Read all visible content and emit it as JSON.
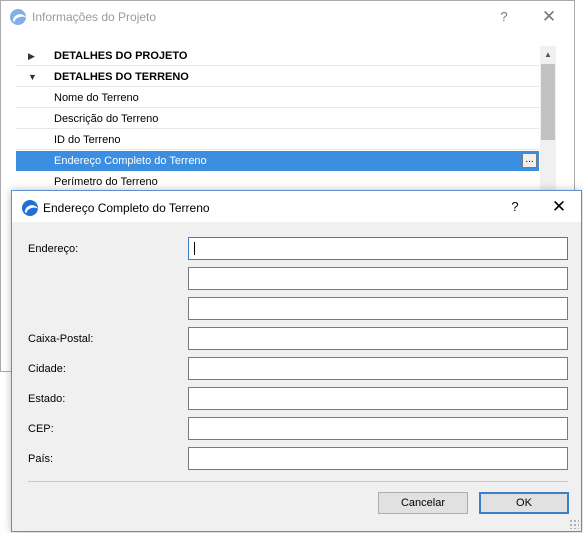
{
  "background_window": {
    "title": "Informações do Projeto",
    "help_glyph": "?",
    "close_glyph": "✕",
    "tree": [
      {
        "label": "DETALHES DO PROJETO",
        "kind": "header",
        "expanded": false
      },
      {
        "label": "DETALHES DO TERRENO",
        "kind": "header",
        "expanded": true
      },
      {
        "label": "Nome do Terreno",
        "kind": "item"
      },
      {
        "label": "Descrição do Terreno",
        "kind": "item"
      },
      {
        "label": "ID do Terreno",
        "kind": "item"
      },
      {
        "label": "Endereço Completo do Terreno",
        "kind": "item",
        "selected": true,
        "browse_glyph": "..."
      },
      {
        "label": "Perímetro do Terreno",
        "kind": "item"
      }
    ]
  },
  "dialog": {
    "title": "Endereço Completo do Terreno",
    "help_glyph": "?",
    "close_glyph": "✕",
    "fields": {
      "address_label": "Endereço:",
      "address_line1": "",
      "address_line2": "",
      "address_line3": "",
      "postal_box_label": "Caixa-Postal:",
      "postal_box": "",
      "city_label": "Cidade:",
      "city": "",
      "state_label": "Estado:",
      "state": "",
      "zip_label": "CEP:",
      "zip": "",
      "country_label": "País:",
      "country": ""
    },
    "buttons": {
      "cancel": "Cancelar",
      "ok": "OK"
    }
  },
  "colors": {
    "selection": "#3c8ee0",
    "focus": "#3c7fc8",
    "dialog_bg": "#f0f0f0"
  },
  "icons": {
    "app": "archicad-logo-icon",
    "collapsed": "triangle-right-icon",
    "expanded": "triangle-down-icon",
    "scroll_up": "scroll-up-arrow-icon"
  }
}
